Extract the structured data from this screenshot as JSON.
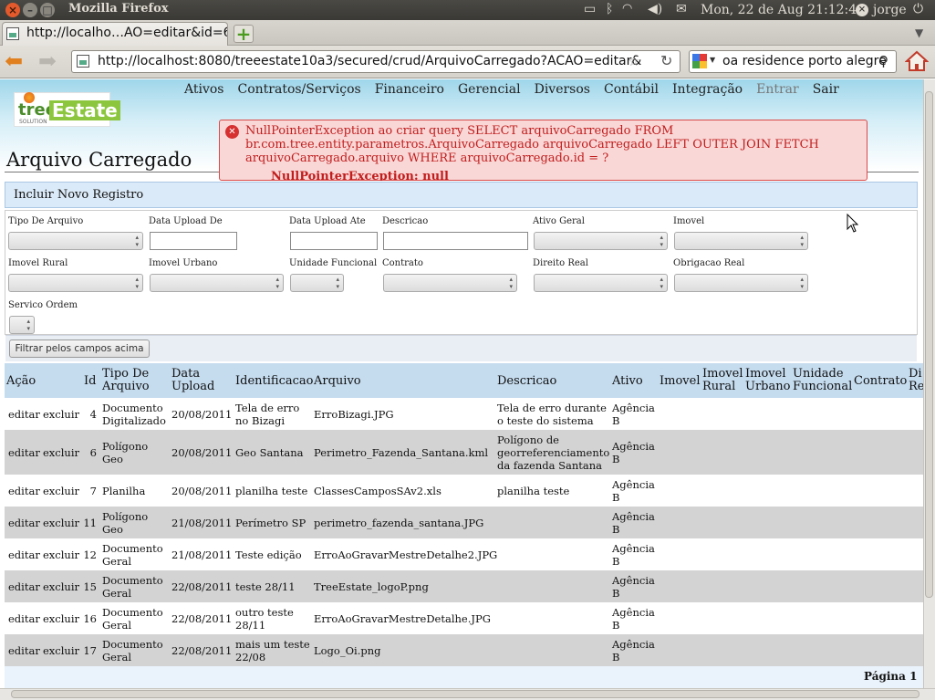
{
  "window": {
    "title": "Mozilla Firefox"
  },
  "tray": {
    "datetime": "Mon, 22 de Aug 21:12:49",
    "user": "jorge"
  },
  "tab": {
    "label": "http://localho…AO=editar&id=6"
  },
  "nav": {
    "url": "http://localhost:8080/treeestate10a3/secured/crud/ArquivoCarregado?ACAO=editar&",
    "search_text": "oa residence porto alegre"
  },
  "logo": {
    "text1": "tree",
    "text2": "Estate",
    "sub": "SOLUTION"
  },
  "menu": [
    "Ativos",
    "Contratos/Serviços",
    "Financeiro",
    "Gerencial",
    "Diversos",
    "Contábil",
    "Integração",
    "Entrar",
    "Sair"
  ],
  "error": {
    "message": "NullPointerException ao criar query SELECT arquivoCarregado FROM br.com.tree.entity.parametros.ArquivoCarregado arquivoCarregado LEFT OUTER JOIN FETCH arquivoCarregado.arquivo WHERE arquivoCarregado.id = ?",
    "detail": "NullPointerException: null"
  },
  "page": {
    "title": "Arquivo Carregado",
    "incluir": "Incluir Novo Registro",
    "filter_button": "Filtrar pelos campos acima",
    "pagina": "Página 1"
  },
  "filters": {
    "tipo_de_arquivo": "Tipo De Arquivo",
    "data_upload_de": "Data Upload De",
    "data_upload_ate": "Data Upload Ate",
    "descricao": "Descricao",
    "ativo_geral": "Ativo Geral",
    "imovel": "Imovel",
    "imovel_rural": "Imovel Rural",
    "imovel_urbano": "Imovel Urbano",
    "unidade_funcional": "Unidade Funcional",
    "contrato": "Contrato",
    "direito_real": "Direito Real",
    "obrigacao_real": "Obrigacao Real",
    "servico_ordem": "Servico Ordem"
  },
  "table": {
    "headers": {
      "acao": "Ação",
      "id": "Id",
      "tipo": "Tipo De Arquivo",
      "data": "Data Upload",
      "identificacao": "Identificacao",
      "arquivo": "Arquivo",
      "descricao": "Descricao",
      "ativo": "Ativo",
      "imovel": "Imovel",
      "imovel_rural": "Imovel Rural",
      "imovel_urbano": "Imovel Urbano",
      "unidade": "Unidade Funcional",
      "contrato": "Contrato",
      "direito": "Di Re"
    },
    "action_edit": "editar",
    "action_delete": "excluir",
    "rows": [
      {
        "id": "4",
        "tipo": "Documento Digitalizado",
        "data": "20/08/2011",
        "ident": "Tela de erro no Bizagi",
        "arquivo": "ErroBizagi.JPG",
        "descricao": "Tela de erro durante o teste do sistema",
        "ativo": "Agência B"
      },
      {
        "id": "6",
        "tipo": "Polígono Geo",
        "data": "20/08/2011",
        "ident": "Geo Santana",
        "arquivo": "Perimetro_Fazenda_Santana.kml",
        "descricao": "Polígono de georreferenciamento da fazenda Santana",
        "ativo": "Agência B"
      },
      {
        "id": "7",
        "tipo": "Planilha",
        "data": "20/08/2011",
        "ident": "planilha teste",
        "arquivo": "ClassesCamposSAv2.xls",
        "descricao": "planilha teste",
        "ativo": "Agência B"
      },
      {
        "id": "11",
        "tipo": "Polígono Geo",
        "data": "21/08/2011",
        "ident": "Perímetro SP",
        "arquivo": "perimetro_fazenda_santana.JPG",
        "descricao": "",
        "ativo": "Agência B"
      },
      {
        "id": "12",
        "tipo": "Documento Geral",
        "data": "21/08/2011",
        "ident": "Teste edição",
        "arquivo": "ErroAoGravarMestreDetalhe2.JPG",
        "descricao": "",
        "ativo": "Agência B"
      },
      {
        "id": "15",
        "tipo": "Documento Geral",
        "data": "22/08/2011",
        "ident": "teste 28/11",
        "arquivo": "TreeEstate_logoP.png",
        "descricao": "",
        "ativo": "Agência B"
      },
      {
        "id": "16",
        "tipo": "Documento Geral",
        "data": "22/08/2011",
        "ident": "outro teste 28/11",
        "arquivo": "ErroAoGravarMestreDetalhe.JPG",
        "descricao": "",
        "ativo": "Agência B"
      },
      {
        "id": "17",
        "tipo": "Documento Geral",
        "data": "22/08/2011",
        "ident": "mais um teste 22/08",
        "arquivo": "Logo_Oi.png",
        "descricao": "",
        "ativo": "Agência B"
      }
    ]
  }
}
